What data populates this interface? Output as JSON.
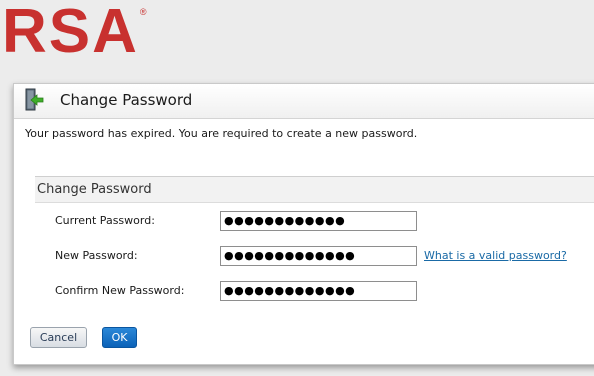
{
  "brand": {
    "logo_text": "RSA",
    "registered_mark": "®",
    "color": "#c8312f"
  },
  "dialog": {
    "title": "Change Password",
    "icon": "door-exit-icon",
    "message": "Your password has expired. You are required to create a new password."
  },
  "form": {
    "section_title": "Change Password",
    "fields": [
      {
        "label": "Current Password:",
        "value": "●●●●●●●●●●●●"
      },
      {
        "label": "New Password:",
        "value": "●●●●●●●●●●●●●"
      },
      {
        "label": "Confirm New Password:",
        "value": "●●●●●●●●●●●●●"
      }
    ],
    "help_link": "What is a valid password?"
  },
  "buttons": {
    "cancel": "Cancel",
    "ok": "OK"
  }
}
